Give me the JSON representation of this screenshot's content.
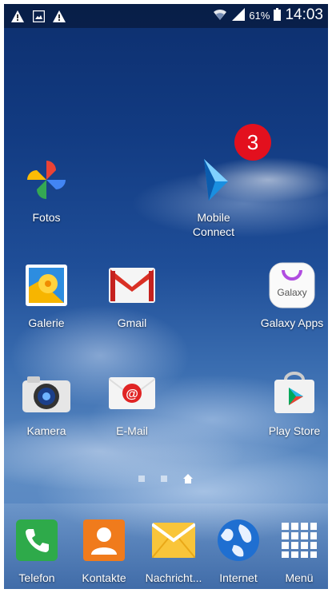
{
  "status_bar": {
    "battery": "61%",
    "time": "14:03",
    "left_icons": [
      "warning-icon",
      "image-icon",
      "warning-icon"
    ],
    "right_icons": [
      "wifi-icon",
      "signal-icon",
      "battery-icon"
    ]
  },
  "badge": {
    "label": "3",
    "color": "#e3101e"
  },
  "home": {
    "row1": {
      "fotos": "Fotos",
      "mobile_connect": "Mobile\nConnect"
    },
    "row2": {
      "galerie": "Galerie",
      "gmail": "Gmail",
      "galaxy_apps": "Galaxy Apps",
      "galaxy_icon_text": "Galaxy"
    },
    "row3": {
      "kamera": "Kamera",
      "email": "E-Mail",
      "play_store": "Play Store"
    }
  },
  "page_indicator": {
    "pages": 3,
    "current": "home"
  },
  "dock": {
    "telefon": "Telefon",
    "kontakte": "Kontakte",
    "nachrichten": "Nachricht...",
    "internet": "Internet",
    "menu": "Menü"
  }
}
